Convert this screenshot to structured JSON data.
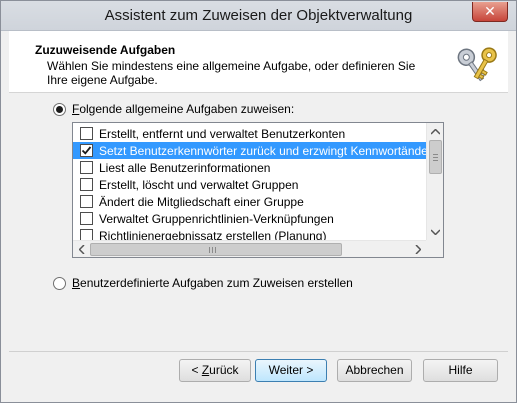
{
  "window": {
    "title": "Assistent zum Zuweisen der Objektverwaltung",
    "close_glyph": "✕"
  },
  "header": {
    "title": "Zuzuweisende Aufgaben",
    "subtitle": "Wählen Sie mindestens eine allgemeine Aufgabe, oder definieren Sie Ihre eigene Aufgabe.",
    "icon": "keys-icon"
  },
  "options": {
    "common": {
      "label": "Folgende allgemeine Aufgaben zuweisen:",
      "selected": true,
      "accesskey": "F"
    },
    "custom": {
      "label": "Benutzerdefinierte Aufgaben zum Zuweisen erstellen",
      "selected": false,
      "accesskey": "B"
    }
  },
  "tasks": [
    {
      "label": "Erstellt, entfernt und verwaltet Benutzerkonten",
      "checked": false,
      "selected": false
    },
    {
      "label": "Setzt Benutzerkennwörter zurück und erzwingt Kennwortänderung bei",
      "checked": true,
      "selected": true
    },
    {
      "label": "Liest alle Benutzerinformationen",
      "checked": false,
      "selected": false
    },
    {
      "label": "Erstellt, löscht und verwaltet Gruppen",
      "checked": false,
      "selected": false
    },
    {
      "label": "Ändert die Mitgliedschaft einer Gruppe",
      "checked": false,
      "selected": false
    },
    {
      "label": "Verwaltet Gruppenrichtlinien-Verknüpfungen",
      "checked": false,
      "selected": false
    },
    {
      "label": "Richtlinienergebnissatz erstellen (Planung)",
      "checked": false,
      "selected": false
    }
  ],
  "buttons": {
    "back": {
      "prefix": "< ",
      "accesskey": "Z",
      "rest": "urück"
    },
    "next": "Weiter >",
    "cancel": "Abbrechen",
    "help": "Hilfe"
  },
  "colors": {
    "selection": "#3399ff",
    "default_button_border": "#3c7fb1",
    "close_button": "#c7453a"
  }
}
